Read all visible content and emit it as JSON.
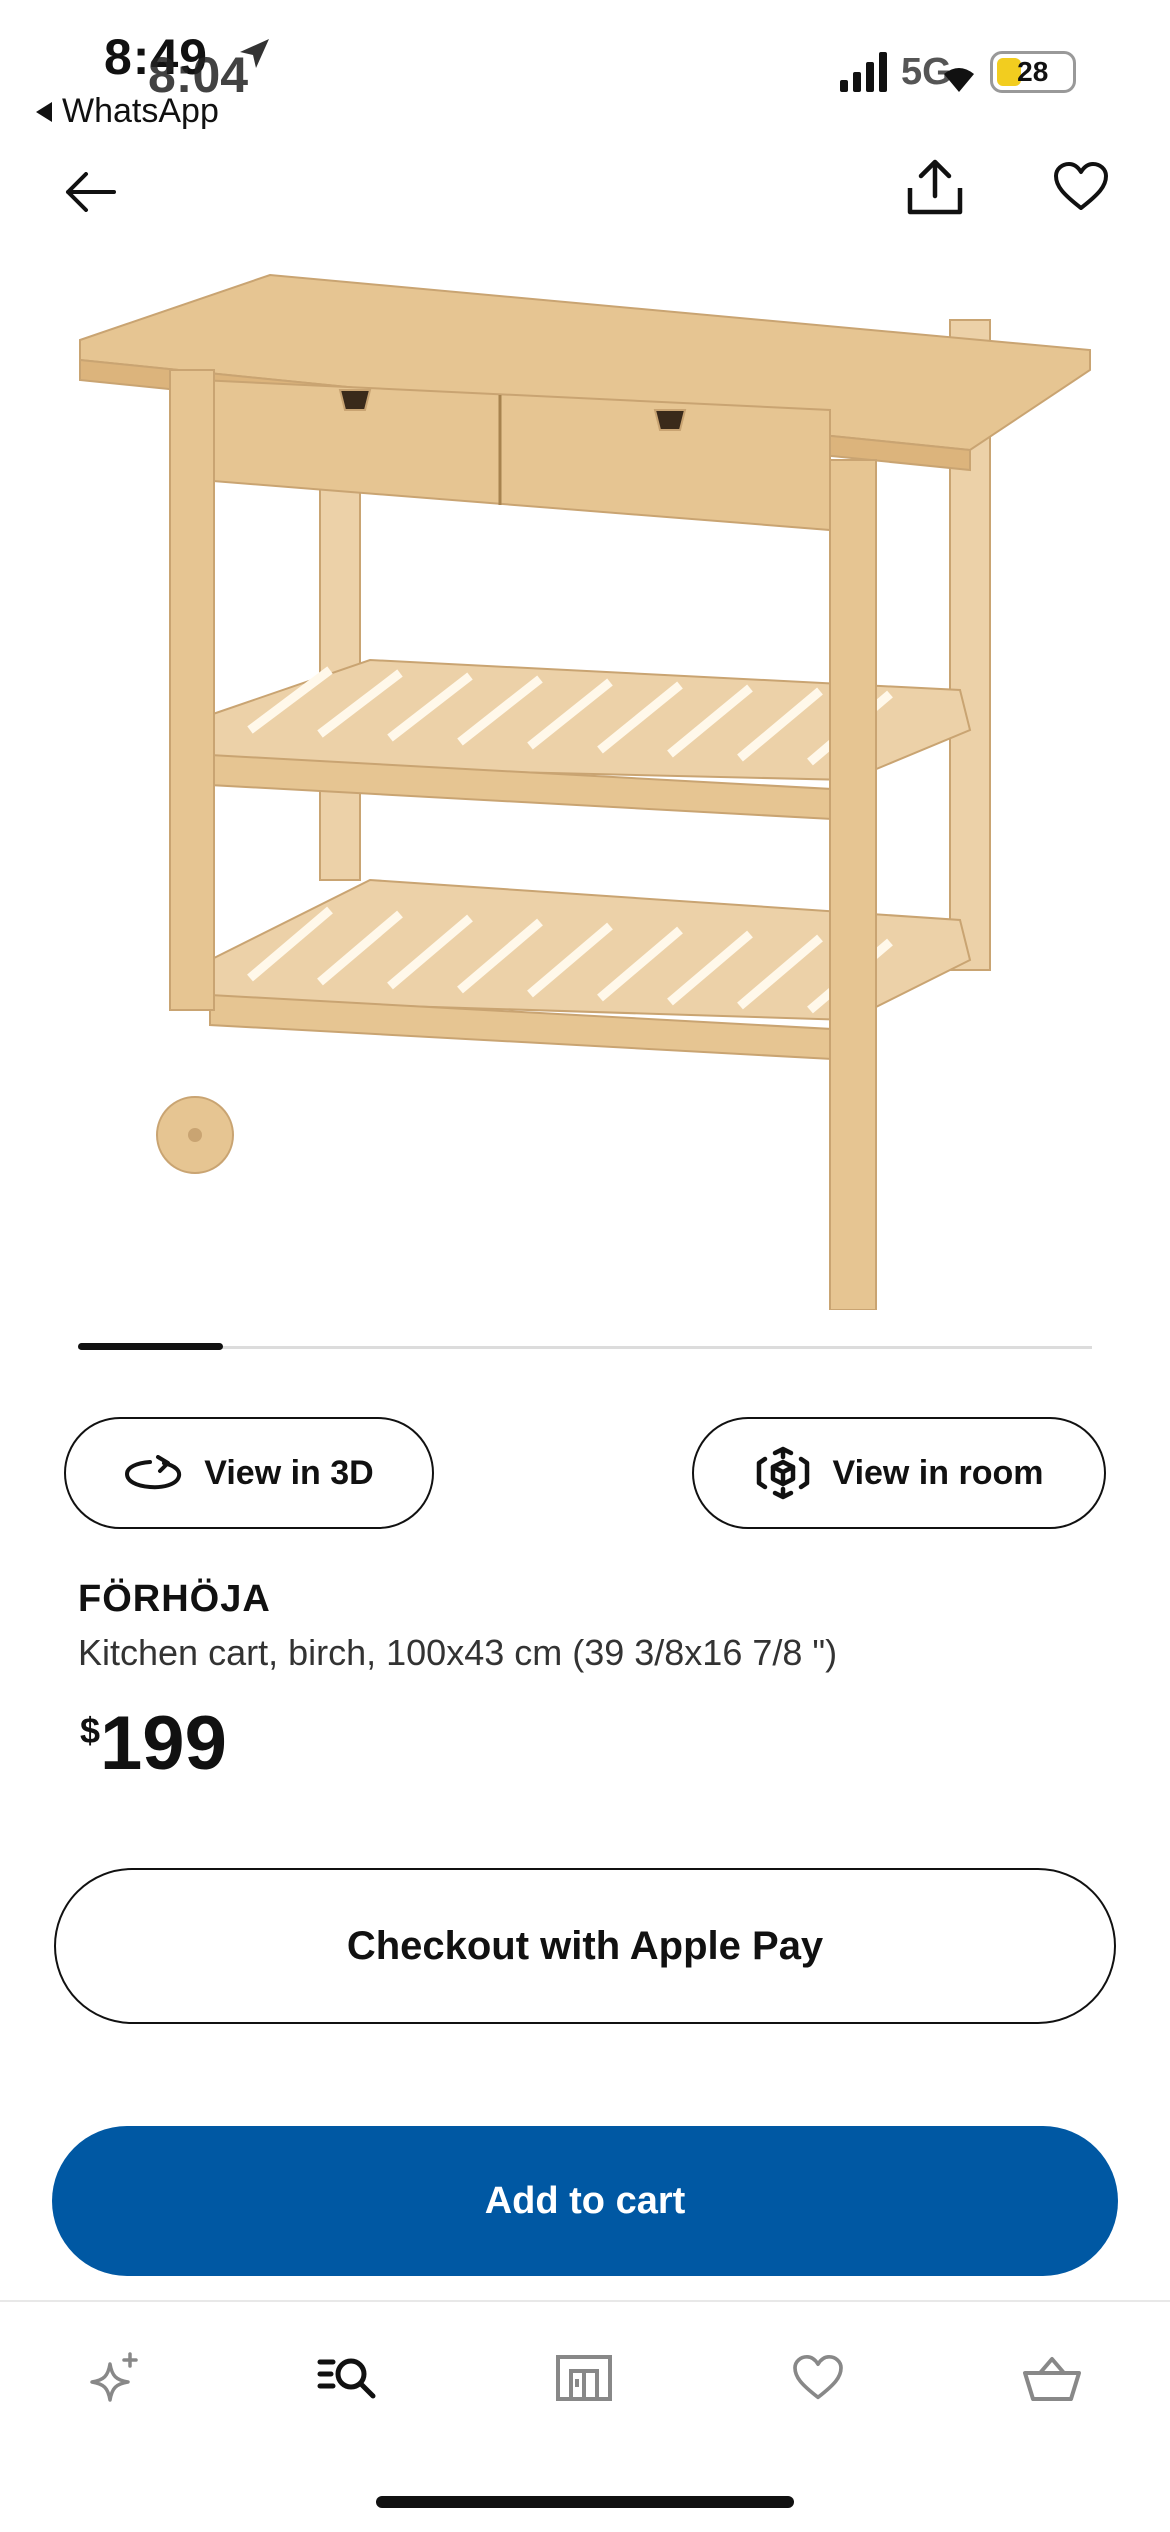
{
  "status_bar": {
    "time": "8:49",
    "time_overlay": "8:04",
    "back_app": "WhatsApp",
    "network": "5G",
    "battery": "28"
  },
  "product": {
    "name": "FÖRHÖJA",
    "description": "Kitchen cart, birch, 100x43 cm (39 3/8x16 7/8 \")",
    "price_currency": "$",
    "price_value": "199",
    "image_index": 1,
    "image_count": 7
  },
  "actions": {
    "view_3d": "View in 3D",
    "view_room": "View in room",
    "apple_pay": "Checkout with Apple Pay",
    "add_to_cart": "Add to cart"
  },
  "tabs": [
    {
      "name": "inspiration",
      "icon": "sparkle-icon"
    },
    {
      "name": "search",
      "icon": "search-list-icon"
    },
    {
      "name": "stores",
      "icon": "store-icon"
    },
    {
      "name": "favourites",
      "icon": "heart-icon"
    },
    {
      "name": "cart",
      "icon": "basket-icon"
    }
  ],
  "colors": {
    "primary_button": "#0058a3",
    "wood": "#e9c99a",
    "battery": "#f2cd1f"
  }
}
